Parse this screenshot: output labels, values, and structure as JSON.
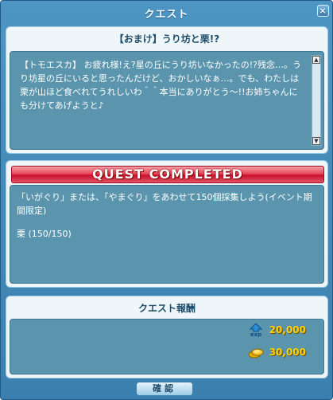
{
  "window": {
    "title": "クエスト",
    "close_glyph": "×"
  },
  "quest": {
    "title": "【おまけ】うり坊と栗!?",
    "dialog": "【トモエスカ】 お疲れ様!え?星の丘にうり坊いなかったの!?残念…。うり坊星の丘にいると思ったんだけど、おかしいなぁ…。でも、わたしは栗が山ほど食べれてうれしいわ＾＾本当にありがとう～!!お姉ちゃんにも分けてあげようと♪"
  },
  "progress": {
    "banner": "QUEST COMPLETED",
    "objective": "「いがぐり」または、「やまぐり」をあわせて150個採集しよう(イベント期間限定)",
    "count": "栗 (150/150)"
  },
  "rewards": {
    "header": "クエスト報酬",
    "exp_value": "20,000",
    "meso_value": "30,000",
    "exp_icon": "exp-icon",
    "meso_icon": "meso-icon"
  },
  "buttons": {
    "confirm": "確認"
  },
  "colors": {
    "accent_red": "#c8102e",
    "reward_gold": "#ffd200",
    "panel_teal": "#5a95ad"
  }
}
